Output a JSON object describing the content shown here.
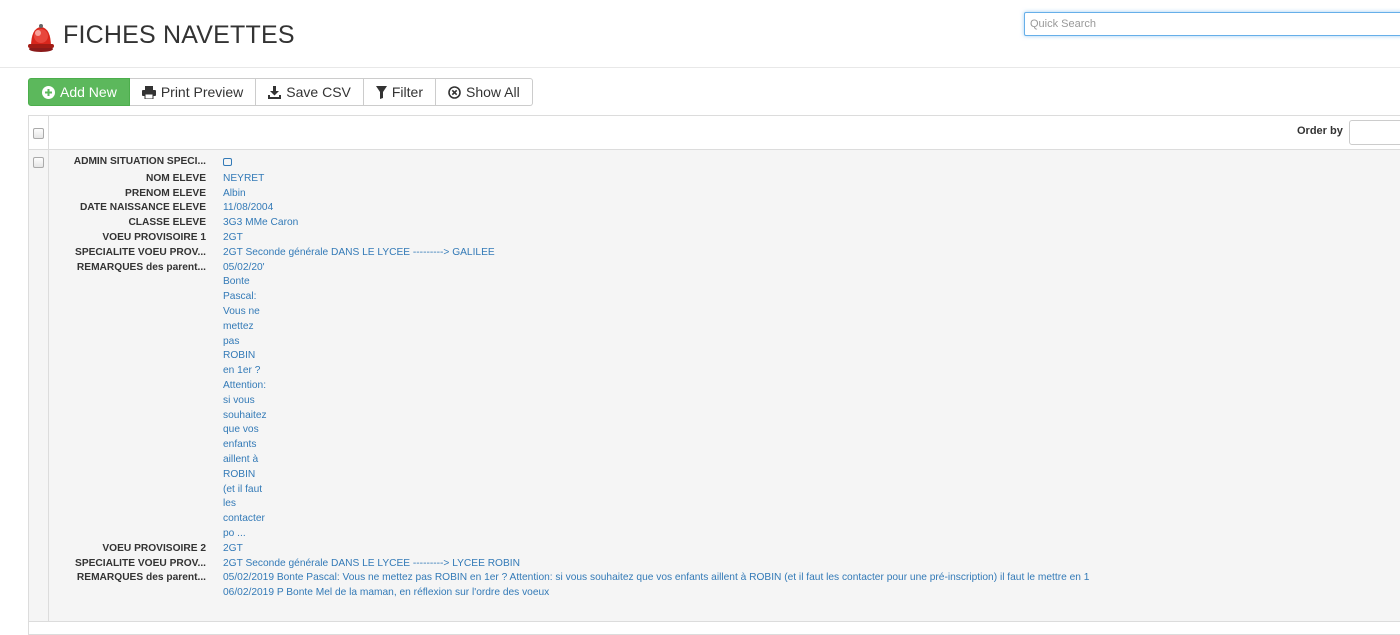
{
  "header": {
    "title": "FICHES NAVETTES",
    "search_placeholder": "Quick Search"
  },
  "toolbar": {
    "add_new": "Add New",
    "print_preview": "Print Preview",
    "save_csv": "Save CSV",
    "filter": "Filter",
    "show_all": "Show All",
    "accent_color": "#5cb85c"
  },
  "grid": {
    "order_by_label": "Order by",
    "record": {
      "fields": [
        {
          "label": "ADMIN SITUATION SPECI...",
          "value": ""
        },
        {
          "label": "NOM ELEVE",
          "value": "NEYRET"
        },
        {
          "label": "PRENOM ELEVE",
          "value": "Albin"
        },
        {
          "label": "DATE NAISSANCE ELEVE",
          "value": "11/08/2004"
        },
        {
          "label": "CLASSE ELEVE",
          "value": "3G3 MMe Caron"
        },
        {
          "label": "VOEU PROVISOIRE 1",
          "value": "2GT"
        },
        {
          "label": "SPECIALITE VOEU PROV...",
          "value": "2GT Seconde générale DANS LE LYCEE ---------> GALILEE"
        },
        {
          "label": "REMARQUES des parent...",
          "value_lines": [
            "05/02/20'",
            "Bonte",
            "Pascal:",
            "Vous ne",
            "mettez",
            "pas",
            "ROBIN",
            "en 1er ?",
            "Attention:",
            "si vous",
            "souhaitez",
            "que vos",
            "enfants",
            "aillent à",
            "ROBIN",
            "(et il faut",
            "les",
            "contacter",
            "po ..."
          ]
        },
        {
          "label": "VOEU PROVISOIRE 2",
          "value": "2GT"
        },
        {
          "label": "SPECIALITE VOEU PROV...",
          "value": "2GT Seconde générale DANS LE LYCEE ---------> LYCEE ROBIN"
        },
        {
          "label": "REMARQUES des parent...",
          "value_lines": [
            "05/02/2019 Bonte Pascal: Vous ne mettez pas ROBIN en 1er ? Attention: si vous souhaitez que vos enfants aillent à ROBIN (et il faut les contacter pour une pré-inscription) il faut le mettre en 1",
            "06/02/2019 P Bonte Mel de la maman, en réflexion sur l'ordre des voeux"
          ]
        }
      ]
    }
  }
}
